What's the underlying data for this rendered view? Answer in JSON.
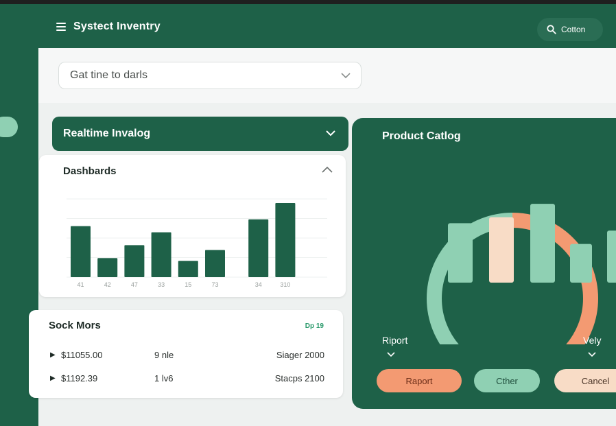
{
  "header": {
    "title": "Systect Inventry",
    "search_label": "Cotton",
    "icons": {
      "menu": "hamburger-icon",
      "search": "search-icon"
    }
  },
  "filter": {
    "select_value": "Gat tine to darls",
    "icon": "chevron-down-icon"
  },
  "realtime_panel": {
    "label": "Realtime Invalog",
    "icon": "chevron-down-icon"
  },
  "dashboard_card": {
    "title": "Dashbards",
    "icon": "chevron-up-icon"
  },
  "stock_card": {
    "title": "Sock Mors",
    "link": "Dp 19",
    "rows": [
      {
        "amount": "$11055.00",
        "qty": "9 nle",
        "stage": "Siager 2000"
      },
      {
        "amount": "$1192.39",
        "qty": "1 lv6",
        "stage": "Stacps 2100"
      }
    ]
  },
  "catalog": {
    "title": "Product Catlog",
    "left_dropdown": "Riport",
    "right_dropdown": "Vely",
    "buttons": {
      "report": "Raport",
      "other": "Cther",
      "cancel": "Cancel"
    }
  },
  "colors": {
    "primary_green": "#1e6148",
    "mint": "#8fd0b3",
    "orange": "#f39a72",
    "peach": "#f8dcc6"
  },
  "chart_data": [
    {
      "type": "bar",
      "categories": [
        "41",
        "42",
        "47",
        "33",
        "15",
        "73",
        "34",
        "310"
      ],
      "values": [
        75,
        28,
        47,
        66,
        24,
        40,
        85,
        109
      ],
      "ylim": [
        0,
        115
      ],
      "grid": true,
      "color": "#1e6148"
    },
    {
      "type": "pie",
      "slices": [
        {
          "label": "",
          "value": 50,
          "color": "#f39a72"
        },
        {
          "label": "",
          "value": 50,
          "color": "#8fd0b3"
        }
      ],
      "bars": {
        "values": [
          80,
          88,
          106,
          52,
          70
        ],
        "colors": [
          "#8fd0b3",
          "#f8dcc6",
          "#8fd0b3",
          "#8fd0b3",
          "#8fd0b3"
        ],
        "ylim": [
          0,
          120
        ]
      }
    }
  ]
}
